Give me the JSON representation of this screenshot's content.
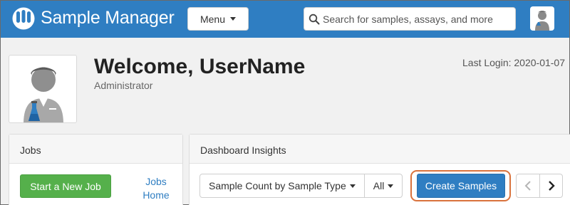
{
  "header": {
    "app_title": "Sample Manager",
    "menu_label": "Menu",
    "search_placeholder": "Search for samples, assays, and more",
    "brand_color": "#2f7ec2"
  },
  "welcome": {
    "title": "Welcome, UserName",
    "role": "Administrator",
    "last_login": "Last Login: 2020-01-07"
  },
  "jobs": {
    "title": "Jobs",
    "start_button": "Start a New Job",
    "home_link": "Jobs Home"
  },
  "insights": {
    "title": "Dashboard Insights",
    "chart_select": "Sample Count by Sample Type",
    "filter_select": "All",
    "create_button": "Create Samples",
    "prev_icon": "chevron-left-icon",
    "next_icon": "chevron-right-icon",
    "highlight_color": "#d9723c"
  }
}
